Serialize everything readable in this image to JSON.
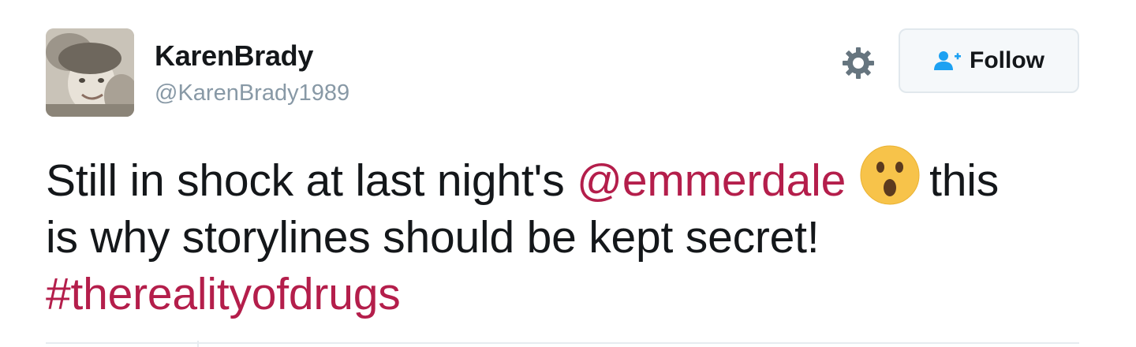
{
  "user": {
    "name": "KarenBrady",
    "handle": "@KarenBrady1989",
    "avatar_icon": "profile-photo"
  },
  "actions": {
    "settings_icon": "gear-icon",
    "follow_label": "Follow",
    "follow_icon": "add-user-icon"
  },
  "tweet": {
    "text_part1": "Still in shock at last night's ",
    "mention": "@emmerdale",
    "emoji": "astonished-face",
    "text_part2": "this",
    "line2": "is why storylines should be kept secret!",
    "hashtag": "#therealityofdrugs"
  },
  "colors": {
    "link": "#b41e4b",
    "follow_icon": "#1da1f2",
    "text": "#14171a",
    "handle": "#8899a6"
  }
}
